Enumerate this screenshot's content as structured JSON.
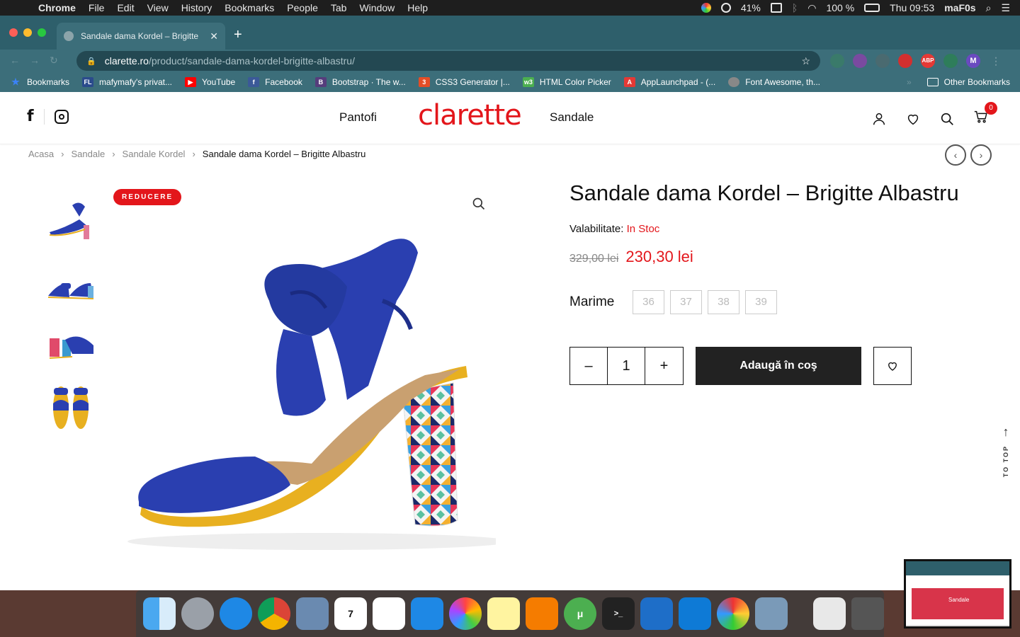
{
  "menubar": {
    "app": "Chrome",
    "items": [
      "File",
      "Edit",
      "View",
      "History",
      "Bookmarks",
      "People",
      "Tab",
      "Window",
      "Help"
    ],
    "battery_level": "41%",
    "battery_percent": "100 %",
    "clock": "Thu 09:53",
    "user": "maF0s"
  },
  "browser": {
    "tab_title": "Sandale dama Kordel – Brigitte",
    "url_host": "clarette.ro",
    "url_path": "/product/sandale-dama-kordel-brigitte-albastru/",
    "profile_initial": "M",
    "bookmarks": [
      {
        "label": "Bookmarks",
        "icon": "star-icon",
        "color": "#3b82f6"
      },
      {
        "label": "mafymafy's privat...",
        "icon": "fl-icon",
        "color": "#2b4b8c"
      },
      {
        "label": "YouTube",
        "icon": "youtube-icon",
        "color": "#ff0000"
      },
      {
        "label": "Facebook",
        "icon": "facebook-icon",
        "color": "#3b5998"
      },
      {
        "label": "Bootstrap · The w...",
        "icon": "bootstrap-icon",
        "color": "#563d7c"
      },
      {
        "label": "CSS3 Generator |...",
        "icon": "css3-icon",
        "color": "#e44d26"
      },
      {
        "label": "HTML Color Picker",
        "icon": "w3-icon",
        "color": "#4caf50"
      },
      {
        "label": "AppLaunchpad - (...",
        "icon": "applaunchpad-icon",
        "color": "#e53935"
      },
      {
        "label": "Font Awesome, th...",
        "icon": "globe-icon",
        "color": "#888888"
      }
    ],
    "other_bookmarks": "Other Bookmarks"
  },
  "site": {
    "nav_left": "Pantofi",
    "nav_right": "Sandale",
    "logo_text_red": "clar",
    "logo_text_black": "ette",
    "cart_count": "0",
    "breadcrumb": [
      "Acasa",
      "Sandale",
      "Sandale Kordel",
      "Sandale dama Kordel – Brigitte Albastru"
    ],
    "badge": "REDUCERE",
    "product": {
      "title": "Sandale dama Kordel – Brigitte Albastru",
      "availability_label": "Valabilitate:",
      "availability_value": "In Stoc",
      "old_price": "329,00 lei",
      "new_price": "230,30 lei",
      "size_label": "Marime",
      "sizes": [
        "36",
        "37",
        "38",
        "39"
      ],
      "qty_minus": "–",
      "qty_value": "1",
      "qty_plus": "+",
      "add_to_cart": "Adaugă în coş"
    },
    "to_top": "TO TOP"
  },
  "colors": {
    "brand_red": "#e3161b",
    "chrome_frame": "#2e5f6b",
    "shoe_blue": "#2a3fb0",
    "sole_yellow": "#e8b020"
  }
}
